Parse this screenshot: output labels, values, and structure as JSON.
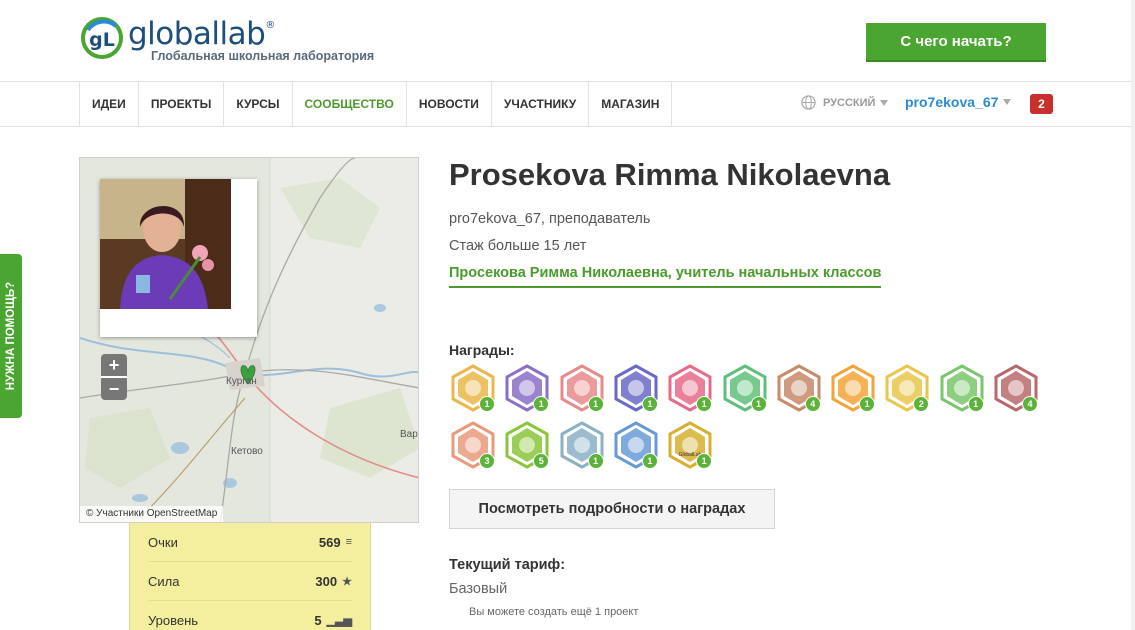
{
  "header": {
    "logo_text": "globallab",
    "logo_trademark": "®",
    "logo_mark_text": "gL",
    "logo_subtitle": "Глобальная школьная лаборатория",
    "start_button": "С чего начать?"
  },
  "nav": {
    "items": [
      {
        "label": "ИДЕИ"
      },
      {
        "label": "ПРОЕКТЫ"
      },
      {
        "label": "КУРСЫ"
      },
      {
        "label": "СООБЩЕСТВО",
        "active": true
      },
      {
        "label": "НОВОСТИ"
      },
      {
        "label": "УЧАСТНИКУ"
      },
      {
        "label": "МАГАЗИН"
      }
    ],
    "language": "РУССКИЙ",
    "username": "pro7ekova_67",
    "notifications": "2",
    "accent": "#4aa531",
    "user_color": "#2a8bd6"
  },
  "help_tab": "НУЖНА ПОМОЩЬ?",
  "map": {
    "city_labels": [
      "Курган",
      "Кетово",
      "Вар"
    ],
    "zoom_in": "+",
    "zoom_out": "−",
    "attribution": "© Участники OpenStreetMap"
  },
  "stats": [
    {
      "label": "Очки",
      "value": "569",
      "icon": "coins-icon",
      "glyph": "≡"
    },
    {
      "label": "Сила",
      "value": "300",
      "icon": "star-icon",
      "glyph": "★"
    },
    {
      "label": "Уровень",
      "value": "5",
      "icon": "level-bars-icon",
      "glyph": "▁▃▅"
    }
  ],
  "profile": {
    "name": "Prosekova Rimma Nikolaevna",
    "role": "pro7ekova_67, преподаватель",
    "experience": "Стаж больше 15 лет",
    "tagline": "Просекова Римма Николаевна, учитель начальных классов"
  },
  "awards": {
    "title": "Награды:",
    "items": [
      {
        "icon": "sun-dial-award-icon",
        "count": "1",
        "color": "#e8b84a"
      },
      {
        "icon": "chalkboard-award-icon",
        "count": "1",
        "color": "#8a6fc6"
      },
      {
        "icon": "people-award-icon",
        "count": "1",
        "color": "#e88a8a"
      },
      {
        "icon": "atom-award-icon",
        "count": "1",
        "color": "#6a6ac6"
      },
      {
        "icon": "microscope-award-icon",
        "count": "1",
        "color": "#e86a8a"
      },
      {
        "icon": "globe-award-icon",
        "count": "1",
        "color": "#5fbf7a"
      },
      {
        "icon": "cart-award-icon",
        "count": "4",
        "color": "#c78a6a"
      },
      {
        "icon": "carrot-award-icon",
        "count": "1",
        "color": "#f2a43a"
      },
      {
        "icon": "book-award-icon",
        "count": "2",
        "color": "#e8c64a"
      },
      {
        "icon": "test-tubes-award-icon",
        "count": "1",
        "color": "#7ac66a"
      },
      {
        "icon": "owl-award-icon",
        "count": "4",
        "color": "#b86a6a"
      },
      {
        "icon": "palette-award-icon",
        "count": "3",
        "color": "#e89a7a"
      },
      {
        "icon": "jester-hat-award-icon",
        "count": "5",
        "color": "#8ac63a"
      },
      {
        "icon": "lighthouse-award-icon",
        "count": "1",
        "color": "#8ab0c6"
      },
      {
        "icon": "typewriter-award-icon",
        "count": "1",
        "color": "#6a9ad6"
      },
      {
        "icon": "globallab-shield-award-icon",
        "count": "1",
        "color": "#d6b030",
        "label": "GlobalLab"
      }
    ],
    "details_button": "Посмотреть подробности о наградах"
  },
  "tariff": {
    "title": "Текущий тариф:",
    "value": "Базовый",
    "note": "Вы можете создать ещё 1 проект"
  }
}
